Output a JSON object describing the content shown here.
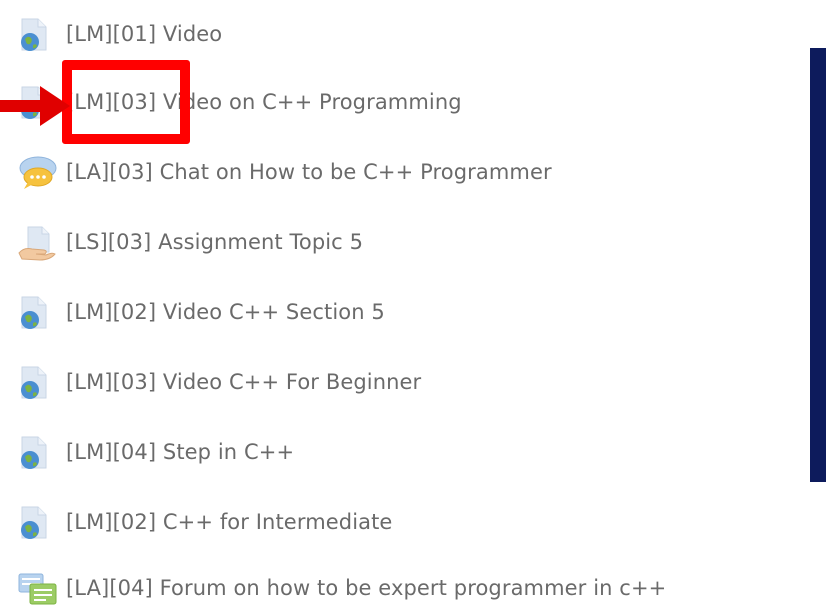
{
  "activities": [
    {
      "label": "[LM][01] Video",
      "icon": "url-globe-icon"
    },
    {
      "label": "[LM][03] Video on C++ Programming",
      "icon": "url-globe-icon"
    },
    {
      "label": "[LA][03] Chat on How to be C++ Programmer",
      "icon": "chat-bubble-icon"
    },
    {
      "label": "[LS][03] Assignment Topic 5",
      "icon": "assignment-hand-icon"
    },
    {
      "label": "[LM][02] Video C++ Section 5",
      "icon": "url-globe-icon"
    },
    {
      "label": "[LM][03] Video C++ For Beginner",
      "icon": "url-globe-icon"
    },
    {
      "label": "[LM][04] Step in C++",
      "icon": "url-globe-icon"
    },
    {
      "label": "[LM][02] C++ for Intermediate",
      "icon": "url-globe-icon"
    },
    {
      "label": "[LA][04] Forum on how to be expert programmer in c++",
      "icon": "forum-icon"
    }
  ],
  "annotation": {
    "highlight_color": "#ff0000",
    "arrow_color": "#e00000"
  },
  "colors": {
    "text": "#6a6a6a",
    "side_bar": "#0d1b5c",
    "doc_page": "#dbe6f2",
    "globe_blue": "#4a8fd1",
    "globe_green": "#7cb342"
  }
}
